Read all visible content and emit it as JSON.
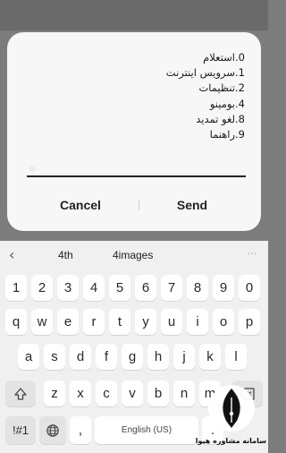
{
  "dialog": {
    "menu_lines": [
      "0.استعلام",
      "1.سرویس اینترنت",
      "2.تنظیمات",
      "4.بومینو",
      "8.لغو تمدید",
      "9.راهنما"
    ],
    "input_value": "",
    "cancel_label": "Cancel",
    "send_label": "Send"
  },
  "keyboard": {
    "suggestions": [
      "4th",
      "4images"
    ],
    "number_row": [
      "1",
      "2",
      "3",
      "4",
      "5",
      "6",
      "7",
      "8",
      "9",
      "0"
    ],
    "row_q": [
      "q",
      "w",
      "e",
      "r",
      "t",
      "y",
      "u",
      "i",
      "o",
      "p"
    ],
    "row_a": [
      "a",
      "s",
      "d",
      "f",
      "g",
      "h",
      "j",
      "k",
      "l"
    ],
    "row_z": [
      "z",
      "x",
      "c",
      "v",
      "b",
      "n",
      "m"
    ],
    "symbols_label": "!#1",
    "comma_label": ",",
    "space_label": "English (US)",
    "period_label": ".",
    "icons": {
      "back": "chevron-left-icon",
      "more": "more-dots-icon",
      "shift": "shift-icon",
      "backspace": "backspace-icon",
      "language": "globe-icon"
    }
  },
  "watermark": {
    "text": "سامانه مشاوره هیوا"
  },
  "colors": {
    "overlay": "#7c7c7c",
    "dialog_bg": "#f7f7f7",
    "keyboard_bg": "#f0f0f0",
    "key_bg": "#ffffff"
  }
}
